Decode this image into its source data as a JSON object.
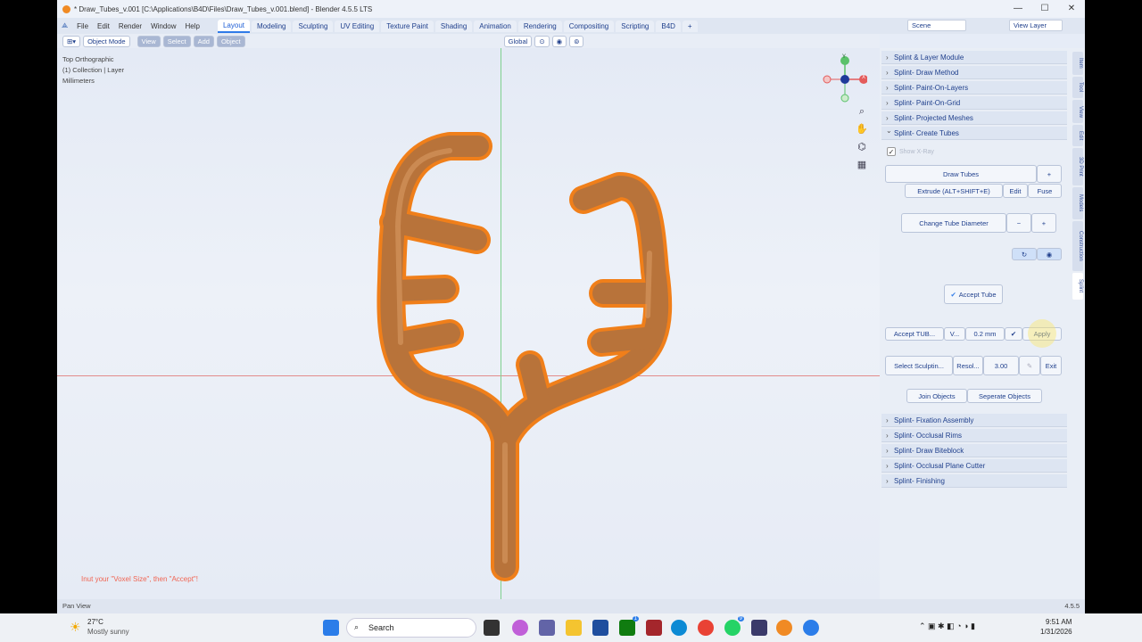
{
  "window": {
    "title": "* Draw_Tubes_v.001 [C:\\Applications\\B4D\\Files\\Draw_Tubes_v.001.blend] - Blender 4.5.5 LTS"
  },
  "menus": [
    "File",
    "Edit",
    "Render",
    "Window",
    "Help"
  ],
  "workspaces": [
    "Layout",
    "Modeling",
    "Sculpting",
    "UV Editing",
    "Texture Paint",
    "Shading",
    "Animation",
    "Rendering",
    "Compositing",
    "Scripting",
    "B4D"
  ],
  "scene": "Scene",
  "view_layer": "View Layer",
  "header": {
    "mode": "Object Mode",
    "view": "View",
    "select": "Select",
    "add": "Add",
    "object": "Object",
    "orientation": "Global"
  },
  "viewport": {
    "line1": "Top Orthographic",
    "line2": "(1) Collection | Layer",
    "line3": "Millimeters",
    "hint": "Inut your \"Voxel Size\", then \"Accept\"!",
    "gizmo": {
      "x": "X",
      "y": "Y"
    }
  },
  "panels_top": [
    "Splint  & Layer Module",
    "Splint- Draw Method",
    "Splint- Paint-On-Layers",
    "Splint- Paint-On-Grid",
    "Splint- Projected Meshes",
    "Splint- Create Tubes"
  ],
  "create_tubes": {
    "show_xray": "Show X-Ray",
    "draw_tubes": "Draw Tubes",
    "plus": "+",
    "extrude": "Extrude  (ALT+SHIFT+E)",
    "edit": "Edit",
    "fuse": "Fuse",
    "change_diameter": "Change Tube Diameter",
    "minus": "−",
    "accept_tube": "Accept Tube",
    "accept_tub": "Accept TUB...",
    "voxel_label": "V...",
    "voxel_value": "0.2 mm",
    "check": "✔",
    "apply": "Apply",
    "select_sculpt": "Select Sculptin...",
    "resol_label": "Resol...",
    "resol_value": "3.00",
    "exit": "Exit",
    "join": "Join Objects",
    "separate": "Seperate Objects"
  },
  "panels_bottom": [
    "Splint- Fixation Assembly",
    "Splint- Occlusal Rims",
    "Splint- Draw Biteblock",
    "Splint- Occlusal Plane Cutter",
    "Splint- Finishing"
  ],
  "vtabs": [
    "Item",
    "Tool",
    "View",
    "Edit",
    "3D Print",
    "Models",
    "Construction",
    "Splint"
  ],
  "status": {
    "left": "Pan View",
    "right": "4.5.5"
  },
  "taskbar": {
    "temp": "27°C",
    "weather": "Mostly sunny",
    "search": "Search",
    "time": "9:51 AM",
    "date": "1/31/2026",
    "badge1": "1",
    "badge2": "9"
  },
  "colors": {
    "accent": "#2f7be8",
    "tube": "#b8733a",
    "outline": "#f07f1a"
  }
}
